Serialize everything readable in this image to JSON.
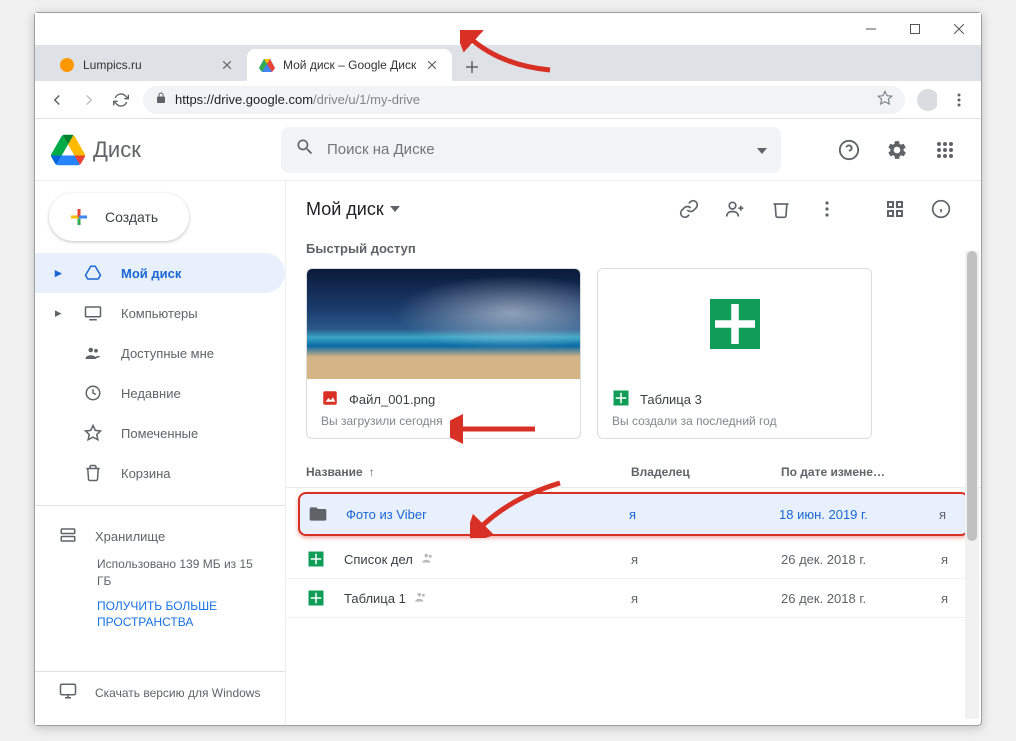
{
  "browser": {
    "tabs": [
      {
        "title": "Lumpics.ru",
        "favicon": "orange"
      },
      {
        "title": "Мой диск – Google Диск",
        "favicon": "drive",
        "active": true
      }
    ],
    "url_domain": "https://drive.google.com",
    "url_path": "/drive/u/1/my-drive"
  },
  "header": {
    "app_name": "Диск",
    "search_placeholder": "Поиск на Диске"
  },
  "create_button": "Создать",
  "sidebar": {
    "items": [
      {
        "label": "Мой диск",
        "active": true
      },
      {
        "label": "Компьютеры"
      },
      {
        "label": "Доступные мне"
      },
      {
        "label": "Недавние"
      },
      {
        "label": "Помеченные"
      },
      {
        "label": "Корзина"
      }
    ],
    "storage_label": "Хранилище",
    "storage_info": "Использовано 139 МБ из 15 ГБ",
    "storage_link": "ПОЛУЧИТЬ БОЛЬШЕ ПРОСТРАНСТВА",
    "download_label": "Скачать версию для Windows"
  },
  "content": {
    "path_title": "Мой диск",
    "quick_title": "Быстрый доступ",
    "quick_cards": [
      {
        "name": "Файл_001.png",
        "sub": "Вы загрузили сегодня",
        "type": "image"
      },
      {
        "name": "Таблица 3",
        "sub": "Вы создали за последний год",
        "type": "sheet"
      }
    ],
    "columns": {
      "name": "Название",
      "owner": "Владелец",
      "date": "По дате измене…"
    },
    "files": [
      {
        "name": "Фото из Viber",
        "owner": "я",
        "date": "18 июн. 2019 г.",
        "last": "я",
        "type": "folder",
        "selected": true
      },
      {
        "name": "Список дел",
        "owner": "я",
        "date": "26 дек. 2018 г.",
        "last": "я",
        "type": "sheet",
        "shared": true
      },
      {
        "name": "Таблица 1",
        "owner": "я",
        "date": "26 дек. 2018 г.",
        "last": "я",
        "type": "sheet",
        "shared": true
      }
    ]
  }
}
